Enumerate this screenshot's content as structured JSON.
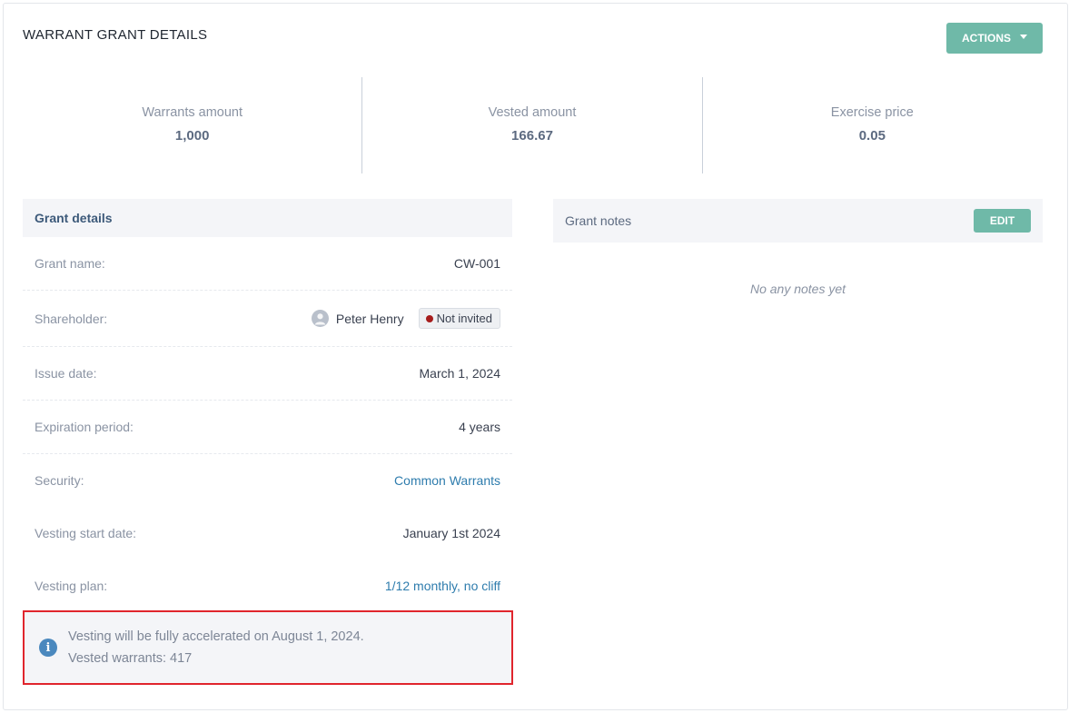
{
  "page": {
    "title": "WARRANT GRANT DETAILS",
    "actions_label": "ACTIONS"
  },
  "stats": [
    {
      "label": "Warrants amount",
      "value": "1,000"
    },
    {
      "label": "Vested amount",
      "value": "166.67"
    },
    {
      "label": "Exercise price",
      "value": "0.05"
    }
  ],
  "grant_details": {
    "title": "Grant details",
    "grant_name": {
      "label": "Grant name:",
      "value": "CW-001"
    },
    "shareholder": {
      "label": "Shareholder:",
      "name": "Peter Henry",
      "status": "Not invited"
    },
    "issue_date": {
      "label": "Issue date:",
      "value": "March 1, 2024"
    },
    "expiration_period": {
      "label": "Expiration period:",
      "value": "4 years"
    },
    "security": {
      "label": "Security:",
      "value": "Common Warrants"
    },
    "vesting_start_date": {
      "label": "Vesting start date:",
      "value": "January 1st 2024"
    },
    "vesting_plan": {
      "label": "Vesting plan:",
      "value": "1/12 monthly, no cliff"
    }
  },
  "notice": {
    "line1": "Vesting will be fully accelerated on August 1, 2024.",
    "line2": "Vested warrants: 417"
  },
  "grant_notes": {
    "title": "Grant notes",
    "edit_label": "EDIT",
    "empty_text": "No any notes yet"
  },
  "colors": {
    "accent": "#6fb9a8",
    "link": "#2e7cad",
    "status_dot": "#a61c1c",
    "highlight_border": "#e0252d",
    "info_icon": "#4a88be"
  },
  "icons": {
    "actions_caret": "caret-down-icon",
    "avatar": "user-avatar-icon",
    "notice": "info-icon"
  }
}
